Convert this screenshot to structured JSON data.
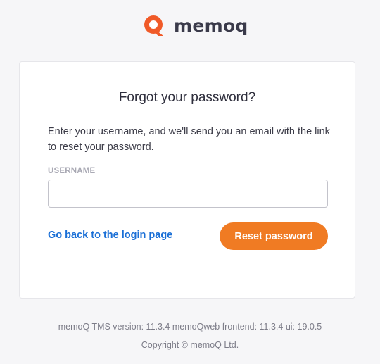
{
  "brand": {
    "name": "memoq",
    "logo_icon": "memoq-logo-icon",
    "accent_color": "#f07b23",
    "logo_color": "#f05a28"
  },
  "reset_form": {
    "title": "Forgot your password?",
    "instructions": "Enter your username, and we'll send you an email with the link to reset your password.",
    "username_label": "USERNAME",
    "username_value": "",
    "back_link_label": "Go back to the login page",
    "submit_label": "Reset password",
    "link_color": "#1a6fd6"
  },
  "footer": {
    "version_text": "memoQ TMS version: 11.3.4 memoQweb frontend: 11.3.4 ui: 19.0.5",
    "copyright_text": "Copyright © memoQ Ltd."
  }
}
